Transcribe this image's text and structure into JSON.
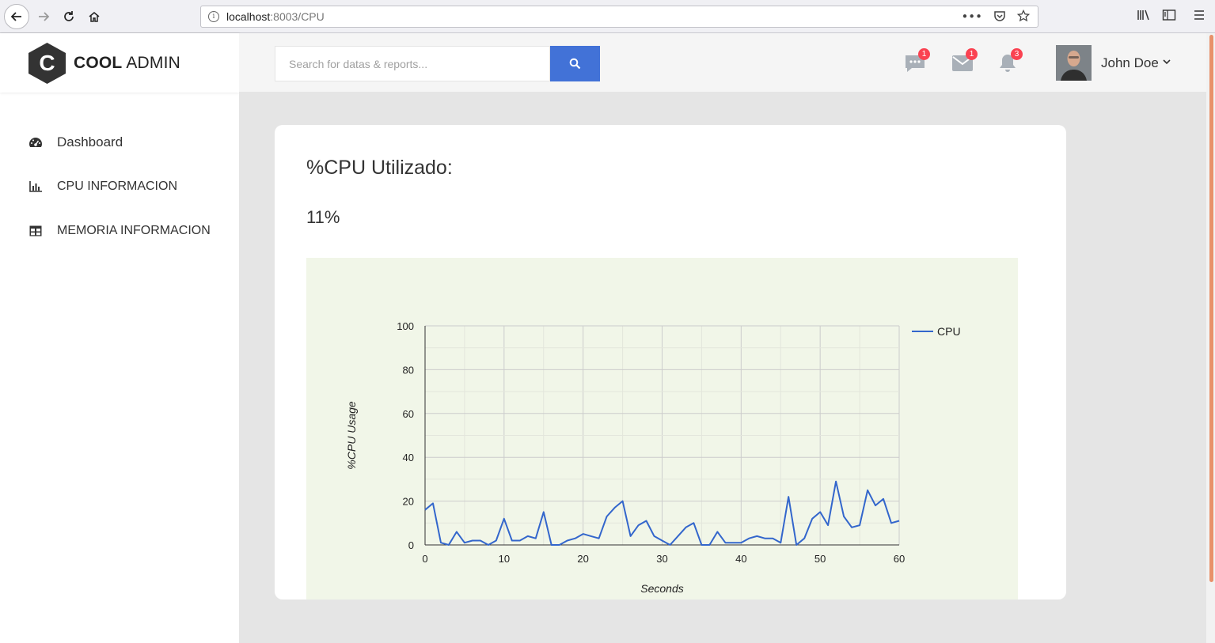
{
  "browser": {
    "url_host": "localhost",
    "url_path": ":8003/CPU"
  },
  "brand": {
    "logo_letter": "C",
    "name_bold": "COOL",
    "name_light": " ADMIN"
  },
  "sidebar": {
    "items": [
      {
        "label": "Dashboard",
        "icon": "dashboard-icon"
      },
      {
        "label": "CPU INFORMACION",
        "icon": "bar-chart-icon"
      },
      {
        "label": "MEMORIA INFORMACION",
        "icon": "table-icon"
      }
    ]
  },
  "header": {
    "search_placeholder": "Search for datas & reports...",
    "notifications": [
      {
        "icon": "chat-icon",
        "count": "1"
      },
      {
        "icon": "mail-icon",
        "count": "1"
      },
      {
        "icon": "bell-icon",
        "count": "3"
      }
    ],
    "user_name": "John Doe"
  },
  "card": {
    "title": "%CPU Utilizado:",
    "value": "11%"
  },
  "colors": {
    "accent": "#4272d7",
    "badge": "#fa4251",
    "series": "#3366cc",
    "chart_bg": "#f1f6e8"
  },
  "chart_data": {
    "type": "line",
    "title": "",
    "xlabel": "Seconds",
    "ylabel": "%CPU Usage",
    "xlim": [
      0,
      60
    ],
    "ylim": [
      0,
      100
    ],
    "xticks": [
      0,
      10,
      20,
      30,
      40,
      50,
      60
    ],
    "yticks": [
      0,
      20,
      40,
      60,
      80,
      100
    ],
    "grid": true,
    "legend_position": "right",
    "series": [
      {
        "name": "CPU",
        "color": "#3366cc",
        "x": [
          0,
          1,
          2,
          3,
          4,
          5,
          6,
          7,
          8,
          9,
          10,
          11,
          12,
          13,
          14,
          15,
          16,
          17,
          18,
          19,
          20,
          21,
          22,
          23,
          24,
          25,
          26,
          27,
          28,
          29,
          30,
          31,
          32,
          33,
          34,
          35,
          36,
          37,
          38,
          39,
          40,
          41,
          42,
          43,
          44,
          45,
          46,
          47,
          48,
          49,
          50,
          51,
          52,
          53,
          54,
          55,
          56,
          57,
          58,
          59,
          60
        ],
        "values": [
          16,
          19,
          1,
          0,
          6,
          1,
          2,
          2,
          0,
          2,
          12,
          2,
          2,
          4,
          3,
          15,
          0,
          0,
          2,
          3,
          5,
          4,
          3,
          13,
          17,
          20,
          4,
          9,
          11,
          4,
          2,
          0,
          4,
          8,
          10,
          0,
          0,
          6,
          1,
          1,
          1,
          3,
          4,
          3,
          3,
          1,
          22,
          0,
          3,
          12,
          15,
          9,
          29,
          13,
          8,
          9,
          25,
          18,
          21,
          10,
          11
        ]
      }
    ]
  }
}
